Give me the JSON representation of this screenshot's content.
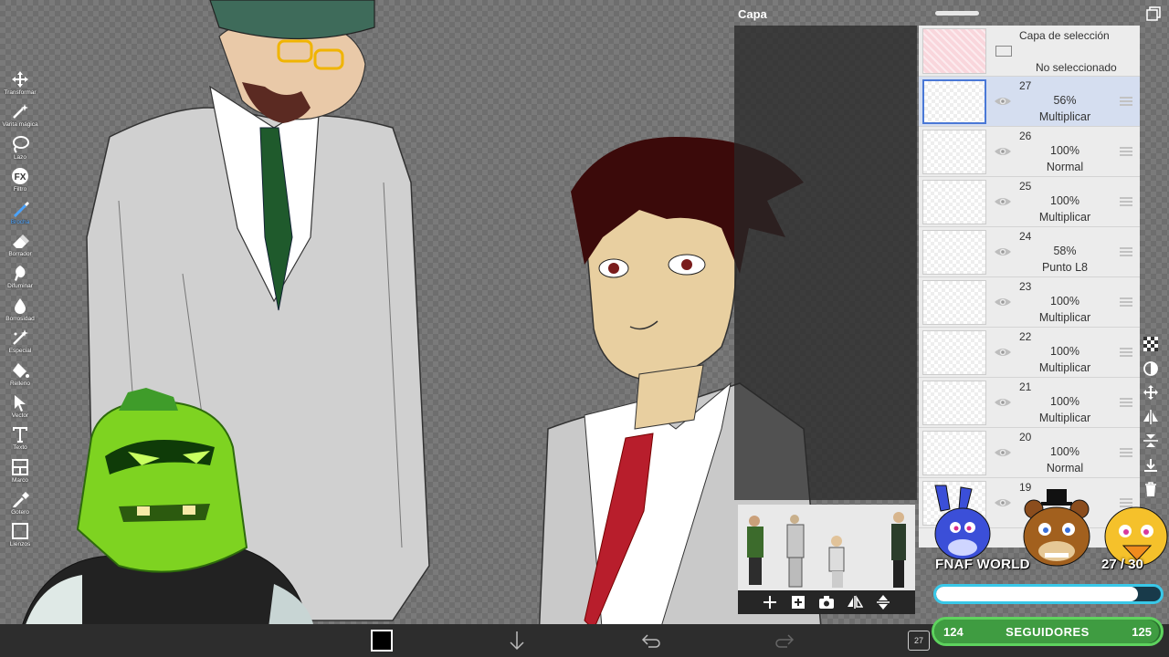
{
  "panel": {
    "title": "Capa",
    "selection_layer": {
      "title": "Capa de selección",
      "status": "No seleccionado"
    },
    "layers": [
      {
        "number": "27",
        "opacity": "56%",
        "mode": "Multiplicar",
        "selected": true
      },
      {
        "number": "26",
        "opacity": "100%",
        "mode": "Normal"
      },
      {
        "number": "25",
        "opacity": "100%",
        "mode": "Multiplicar"
      },
      {
        "number": "24",
        "opacity": "58%",
        "mode": "Punto L8"
      },
      {
        "number": "23",
        "opacity": "100%",
        "mode": "Multiplicar"
      },
      {
        "number": "22",
        "opacity": "100%",
        "mode": "Multiplicar"
      },
      {
        "number": "21",
        "opacity": "100%",
        "mode": "Multiplicar"
      },
      {
        "number": "20",
        "opacity": "100%",
        "mode": "Normal"
      },
      {
        "number": "19",
        "opacity": "",
        "mode": ""
      }
    ]
  },
  "toolbar": {
    "tools": [
      {
        "label": "Transformar",
        "icon": "move-icon"
      },
      {
        "label": "Varita mágica",
        "icon": "magic-wand-icon"
      },
      {
        "label": "Lazo",
        "icon": "lasso-icon"
      },
      {
        "label": "Filtro",
        "icon": "fx-icon"
      },
      {
        "label": "Brocha",
        "icon": "brush-icon",
        "active": true
      },
      {
        "label": "Borrador",
        "icon": "eraser-icon"
      },
      {
        "label": "Difuminar",
        "icon": "smudge-icon"
      },
      {
        "label": "Borrosidad",
        "icon": "blur-icon"
      },
      {
        "label": "Especial",
        "icon": "special-icon"
      },
      {
        "label": "Relleno",
        "icon": "fill-icon"
      },
      {
        "label": "Vector",
        "icon": "vector-icon"
      },
      {
        "label": "Texto",
        "icon": "text-icon"
      },
      {
        "label": "Marco",
        "icon": "frame-icon"
      },
      {
        "label": "Gotero",
        "icon": "eyedropper-icon"
      },
      {
        "label": "Lienzos",
        "icon": "canvas-icon"
      }
    ]
  },
  "bottom_bar": {
    "layer_count": "27",
    "current_color": "#000000"
  },
  "overlay": {
    "game_title": "FNAF WORLD",
    "game_progress": "27 / 30",
    "game_progress_fraction": 0.9,
    "followers_current": "124",
    "followers_label": "SEGUIDORES",
    "followers_goal": "125",
    "followers_fraction": 0.99
  },
  "colors": {
    "panel_bg": "#ececec",
    "selected_layer": "#d5def0",
    "accent_blue": "#4aa3ff",
    "progress_border": "#39c8e8",
    "followers_green": "#5ed35e"
  }
}
